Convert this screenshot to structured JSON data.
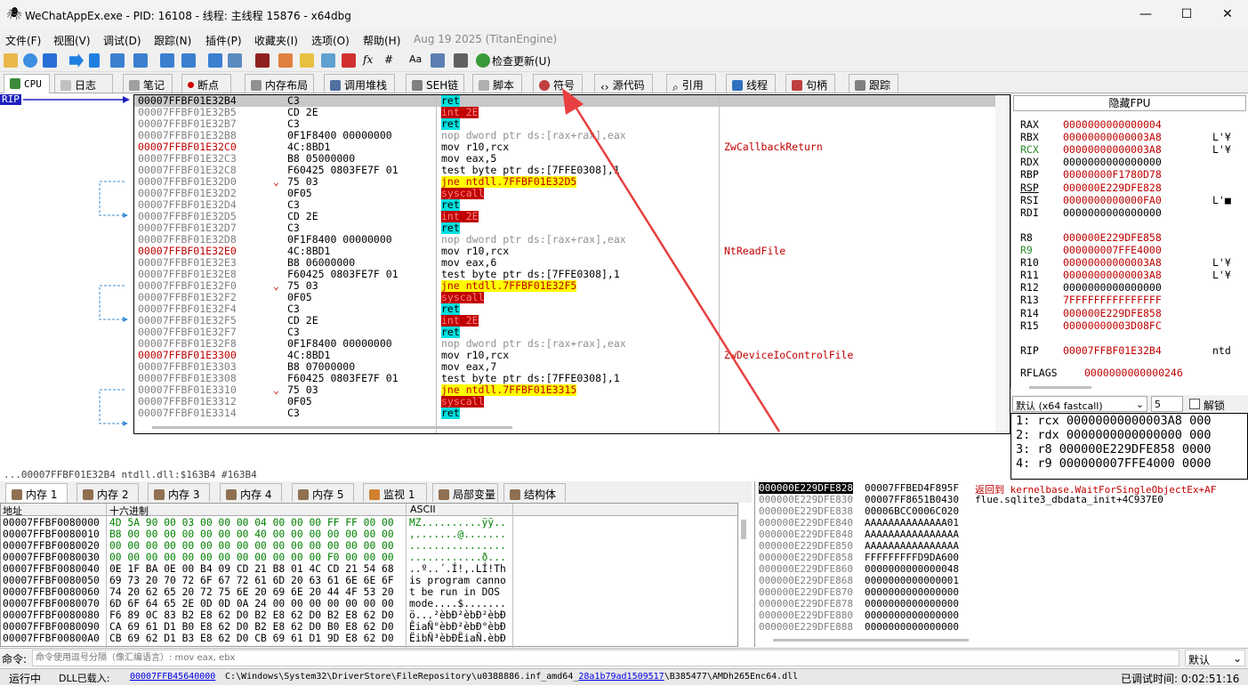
{
  "title": {
    "text": "WeChatAppEx.exe - PID: 16108 - 线程: 主线程 15876 - x64dbg",
    "min": "—",
    "max": "☐",
    "close": "✕"
  },
  "menu": [
    "文件(F)",
    "视图(V)",
    "调试(D)",
    "跟踪(N)",
    "插件(P)",
    "收藏夹(I)",
    "选项(O)",
    "帮助(H)",
    "Aug 19 2025 (TitanEngine)"
  ],
  "toolbar": {
    "check_update": "检查更新(U)"
  },
  "tabs": [
    "CPU",
    "日志",
    "笔记",
    "断点",
    "内存布局",
    "调用堆栈",
    "SEH链",
    "脚本",
    "符号",
    "源代码",
    "引用",
    "线程",
    "句柄",
    "跟踪"
  ],
  "rip_label": "RIP",
  "disasm": [
    {
      "addr": "00007FFBF01E32B4",
      "hex": "C3",
      "asm": "ret",
      "style": "cyan",
      "cmt": "",
      "addrcolor": "#000000",
      "rip": true
    },
    {
      "addr": "00007FFBF01E32B5",
      "hex": "CD 2E",
      "asm": "int 2E",
      "style": "red",
      "cmt": "",
      "addrcolor": "#808080"
    },
    {
      "addr": "00007FFBF01E32B7",
      "hex": "C3",
      "asm": "ret",
      "style": "cyan",
      "cmt": "",
      "addrcolor": "#808080"
    },
    {
      "addr": "00007FFBF01E32B8",
      "hex": "0F1F8400 00000000",
      "asm": "nop dword ptr ds:[rax+rax],eax",
      "style": "gray",
      "cmt": "",
      "addrcolor": "#808080"
    },
    {
      "addr": "00007FFBF01E32C0",
      "hex": "4C:8BD1",
      "asm": "mov r10,rcx",
      "style": "",
      "cmt": "ZwCallbackReturn",
      "addrcolor": "#c00000"
    },
    {
      "addr": "00007FFBF01E32C3",
      "hex": "B8 05000000",
      "asm": "mov eax,5",
      "style": "",
      "cmt": "",
      "addrcolor": "#808080"
    },
    {
      "addr": "00007FFBF01E32C8",
      "hex": "F60425 0803FE7F 01",
      "asm": "test byte ptr ds:[7FFE0308],1",
      "style": "test",
      "cmt": "",
      "addrcolor": "#808080"
    },
    {
      "addr": "00007FFBF01E32D0",
      "hex": "75 03",
      "asm": "jne ntdll.7FFBF01E32D5",
      "style": "jne",
      "cmt": "",
      "addrcolor": "#808080"
    },
    {
      "addr": "00007FFBF01E32D2",
      "hex": "0F05",
      "asm": "syscall",
      "style": "red",
      "cmt": "",
      "addrcolor": "#808080"
    },
    {
      "addr": "00007FFBF01E32D4",
      "hex": "C3",
      "asm": "ret",
      "style": "cyan",
      "cmt": "",
      "addrcolor": "#808080"
    },
    {
      "addr": "00007FFBF01E32D5",
      "hex": "CD 2E",
      "asm": "int 2E",
      "style": "red",
      "cmt": "",
      "addrcolor": "#808080"
    },
    {
      "addr": "00007FFBF01E32D7",
      "hex": "C3",
      "asm": "ret",
      "style": "cyan",
      "cmt": "",
      "addrcolor": "#808080"
    },
    {
      "addr": "00007FFBF01E32D8",
      "hex": "0F1F8400 00000000",
      "asm": "nop dword ptr ds:[rax+rax],eax",
      "style": "gray",
      "cmt": "",
      "addrcolor": "#808080"
    },
    {
      "addr": "00007FFBF01E32E0",
      "hex": "4C:8BD1",
      "asm": "mov r10,rcx",
      "style": "",
      "cmt": "NtReadFile",
      "addrcolor": "#c00000"
    },
    {
      "addr": "00007FFBF01E32E3",
      "hex": "B8 06000000",
      "asm": "mov eax,6",
      "style": "",
      "cmt": "",
      "addrcolor": "#808080"
    },
    {
      "addr": "00007FFBF01E32E8",
      "hex": "F60425 0803FE7F 01",
      "asm": "test byte ptr ds:[7FFE0308],1",
      "style": "test",
      "cmt": "",
      "addrcolor": "#808080"
    },
    {
      "addr": "00007FFBF01E32F0",
      "hex": "75 03",
      "asm": "jne ntdll.7FFBF01E32F5",
      "style": "jne",
      "cmt": "",
      "addrcolor": "#808080"
    },
    {
      "addr": "00007FFBF01E32F2",
      "hex": "0F05",
      "asm": "syscall",
      "style": "red",
      "cmt": "",
      "addrcolor": "#808080"
    },
    {
      "addr": "00007FFBF01E32F4",
      "hex": "C3",
      "asm": "ret",
      "style": "cyan",
      "cmt": "",
      "addrcolor": "#808080"
    },
    {
      "addr": "00007FFBF01E32F5",
      "hex": "CD 2E",
      "asm": "int 2E",
      "style": "red",
      "cmt": "",
      "addrcolor": "#808080"
    },
    {
      "addr": "00007FFBF01E32F7",
      "hex": "C3",
      "asm": "ret",
      "style": "cyan",
      "cmt": "",
      "addrcolor": "#808080"
    },
    {
      "addr": "00007FFBF01E32F8",
      "hex": "0F1F8400 00000000",
      "asm": "nop dword ptr ds:[rax+rax],eax",
      "style": "gray",
      "cmt": "",
      "addrcolor": "#808080"
    },
    {
      "addr": "00007FFBF01E3300",
      "hex": "4C:8BD1",
      "asm": "mov r10,rcx",
      "style": "",
      "cmt": "ZwDeviceIoControlFile",
      "addrcolor": "#c00000"
    },
    {
      "addr": "00007FFBF01E3303",
      "hex": "B8 07000000",
      "asm": "mov eax,7",
      "style": "",
      "cmt": "",
      "addrcolor": "#808080"
    },
    {
      "addr": "00007FFBF01E3308",
      "hex": "F60425 0803FE7F 01",
      "asm": "test byte ptr ds:[7FFE0308],1",
      "style": "test",
      "cmt": "",
      "addrcolor": "#808080"
    },
    {
      "addr": "00007FFBF01E3310",
      "hex": "75 03",
      "asm": "jne ntdll.7FFBF01E3315",
      "style": "jne",
      "cmt": "",
      "addrcolor": "#808080"
    },
    {
      "addr": "00007FFBF01E3312",
      "hex": "0F05",
      "asm": "syscall",
      "style": "red",
      "cmt": "",
      "addrcolor": "#808080"
    },
    {
      "addr": "00007FFBF01E3314",
      "hex": "C3",
      "asm": "ret",
      "style": "cyan",
      "cmt": "",
      "addrcolor": "#808080"
    }
  ],
  "fpu_header": "隐藏FPU",
  "registers": [
    {
      "n": "RAX",
      "v": "0000000000000004",
      "x": ""
    },
    {
      "n": "RBX",
      "v": "00000000000003A8",
      "x": "L'¥"
    },
    {
      "n": "RCX",
      "v": "00000000000003A8",
      "x": "L'¥"
    },
    {
      "n": "RDX",
      "v": "0000000000000000",
      "x": ""
    },
    {
      "n": "RBP",
      "v": "00000000F1780D78",
      "x": ""
    },
    {
      "n": "RSP",
      "v": "000000E229DFE828",
      "x": ""
    },
    {
      "n": "RSI",
      "v": "0000000000000FA0",
      "x": "L'■"
    },
    {
      "n": "RDI",
      "v": "0000000000000000",
      "x": ""
    },
    {
      "n": "",
      "v": "",
      "x": ""
    },
    {
      "n": "R8",
      "v": "000000E229DFE858",
      "x": ""
    },
    {
      "n": "R9",
      "v": "000000007FFE4000",
      "x": ""
    },
    {
      "n": "R10",
      "v": "00000000000003A8",
      "x": "L'¥"
    },
    {
      "n": "R11",
      "v": "00000000000003A8",
      "x": "L'¥"
    },
    {
      "n": "R12",
      "v": "0000000000000000",
      "x": ""
    },
    {
      "n": "R13",
      "v": "7FFFFFFFFFFFFFFF",
      "x": ""
    },
    {
      "n": "R14",
      "v": "000000E229DFE858",
      "x": ""
    },
    {
      "n": "R15",
      "v": "00000000003D08FC",
      "x": ""
    },
    {
      "n": "",
      "v": "",
      "x": ""
    },
    {
      "n": "RIP",
      "v": "00007FFBF01E32B4",
      "x": "ntd"
    }
  ],
  "rflags": {
    "n": "RFLAGS",
    "v": "0000000000000246"
  },
  "callconv": {
    "value": "默认 (x64 fastcall)",
    "count": "5",
    "unlock": "解锁"
  },
  "stack_args": [
    "1: rcx 00000000000003A8 000",
    "2: rdx 0000000000000000 000",
    "3: r8 000000E229DFE858 0000",
    "4: r9 000000007FFE4000 0000"
  ],
  "mid_info": "...00007FFBF01E32B4 ntdll.dll:$163B4 #163B4",
  "memtabs": [
    "内存 1",
    "内存 2",
    "内存 3",
    "内存 4",
    "内存 5",
    "监视 1",
    "局部变量",
    "结构体"
  ],
  "dump_headers": {
    "addr": "地址",
    "hex": "十六进制",
    "ascii": "ASCII"
  },
  "dump": [
    {
      "a": "00007FFBF0080000",
      "h": "4D 5A 90 00 03 00 00 00 04 00 00 00 FF FF 00 00",
      "s": "MZ..........ÿÿ.."
    },
    {
      "a": "00007FFBF0080010",
      "h": "B8 00 00 00 00 00 00 00 40 00 00 00 00 00 00 00",
      "s": ",.......@......."
    },
    {
      "a": "00007FFBF0080020",
      "h": "00 00 00 00 00 00 00 00 00 00 00 00 00 00 00 00",
      "s": "................"
    },
    {
      "a": "00007FFBF0080030",
      "h": "00 00 00 00 00 00 00 00 00 00 00 00 F0 00 00 00",
      "s": "............ð..."
    },
    {
      "a": "00007FFBF0080040",
      "h": "0E 1F BA 0E 00 B4 09 CD 21 B8 01 4C CD 21 54 68",
      "s": "..º..´.Í!,.LÍ!Th"
    },
    {
      "a": "00007FFBF0080050",
      "h": "69 73 20 70 72 6F 67 72 61 6D 20 63 61 6E 6E 6F",
      "s": "is program canno"
    },
    {
      "a": "00007FFBF0080060",
      "h": "74 20 62 65 20 72 75 6E 20 69 6E 20 44 4F 53 20",
      "s": "t be run in DOS "
    },
    {
      "a": "00007FFBF0080070",
      "h": "6D 6F 64 65 2E 0D 0D 0A 24 00 00 00 00 00 00 00",
      "s": "mode....$......."
    },
    {
      "a": "00007FFBF0080080",
      "h": "F6 89 0C 83 B2 E8 62 D0 B2 E8 62 D0 B2 E8 62 D0",
      "s": "ö...²èbÐ²èbÐ²èbÐ"
    },
    {
      "a": "00007FFBF0080090",
      "h": "CA 69 61 D1 B0 E8 62 D0 B2 E8 62 D0 B0 E8 62 D0",
      "s": "ÊiaÑ°èbÐ²èbÐ°èbÐ"
    },
    {
      "a": "00007FFBF00800A0",
      "h": "CB 69 62 D1 B3 E8 62 D0 CB 69 61 D1 9D E8 62 D0",
      "s": "ËibÑ³èbÐËiaÑ.èbÐ"
    }
  ],
  "stack": [
    {
      "a": "000000E229DFE828",
      "v": "00007FFBED4F895F",
      "c": "返回到 kernelbase.WaitForSingleObjectEx+AF"
    },
    {
      "a": "000000E229DFE830",
      "v": "00007FF8651B0430",
      "c": "flue.sqlite3_dbdata_init+4C937E0"
    },
    {
      "a": "000000E229DFE838",
      "v": "00006BCC0006C020",
      "c": ""
    },
    {
      "a": "000000E229DFE840",
      "v": "AAAAAAAAAAAAAA01",
      "c": ""
    },
    {
      "a": "000000E229DFE848",
      "v": "AAAAAAAAAAAAAAAA",
      "c": ""
    },
    {
      "a": "000000E229DFE850",
      "v": "AAAAAAAAAAAAAAAA",
      "c": ""
    },
    {
      "a": "000000E229DFE858",
      "v": "FFFFFFFFFD9DA600",
      "c": ""
    },
    {
      "a": "000000E229DFE860",
      "v": "0000000000000048",
      "c": ""
    },
    {
      "a": "000000E229DFE868",
      "v": "0000000000000001",
      "c": ""
    },
    {
      "a": "000000E229DFE870",
      "v": "0000000000000000",
      "c": ""
    },
    {
      "a": "000000E229DFE878",
      "v": "0000000000000000",
      "c": ""
    },
    {
      "a": "000000E229DFE880",
      "v": "0000000000000000",
      "c": ""
    },
    {
      "a": "000000E229DFE888",
      "v": "0000000000000000",
      "c": ""
    }
  ],
  "cmd": {
    "label": "命令:",
    "placeholder": "命令使用逗号分隔（像汇编语言）: mov eax, ebx",
    "mode": "默认"
  },
  "status": {
    "state": "运行中",
    "dll_label": "DLL已载入:",
    "dll_addr": "00007FFB45640000",
    "path1": "C:\\Windows\\System32\\DriverStore\\FileRepository\\u0388886.inf_amd64_",
    "path_link": "28a1b79ad1509517",
    "path2": "\\B385477\\AMDh265Enc64.dll",
    "elapsed": "已调试时间: 0:02:51:16"
  }
}
